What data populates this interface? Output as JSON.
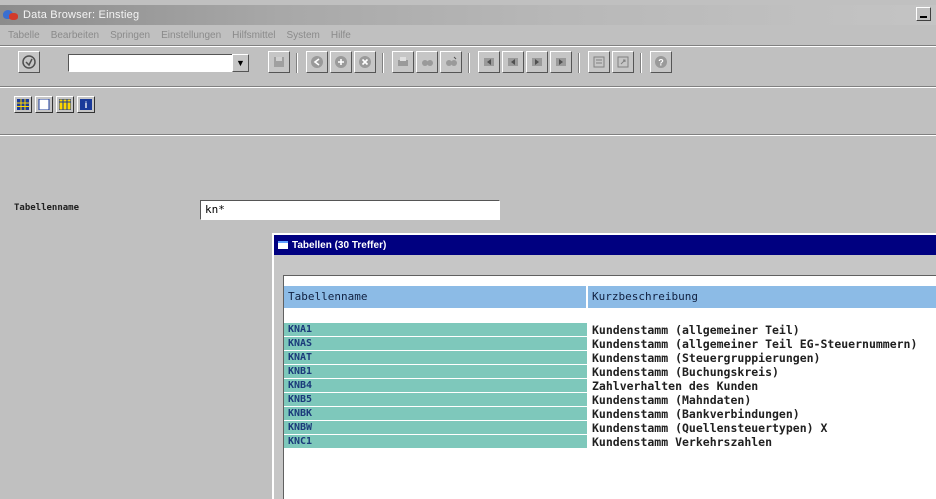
{
  "window": {
    "title": "Data Browser: Einstieg"
  },
  "menu": [
    "Tabelle",
    "Bearbeiten",
    "Springen",
    "Einstellungen",
    "Hilfsmittel",
    "System",
    "Hilfe"
  ],
  "toolbar": {
    "command_value": "",
    "buttons": [
      "enter-icon",
      "save-icon",
      "back-icon",
      "exit-icon",
      "cancel-icon",
      "print-icon",
      "find-icon",
      "find-next-icon",
      "first-page-icon",
      "prev-page-icon",
      "next-page-icon",
      "last-page-icon",
      "create-session-icon",
      "shortcut-icon",
      "help-icon"
    ]
  },
  "app_toolbar": {
    "buttons": [
      "table-contents-icon",
      "new-entries-icon",
      "table-icon",
      "info-icon"
    ]
  },
  "form": {
    "label": "Tabellenname",
    "value": "kn*"
  },
  "popup": {
    "title": "Tabellen (30 Treffer)",
    "headers": [
      "Tabellenname",
      "Kurzbeschreibung"
    ],
    "rows": [
      {
        "name": "KNA1",
        "desc": "Kundenstamm (allgemeiner Teil)"
      },
      {
        "name": "KNAS",
        "desc": "Kundenstamm (allgemeiner Teil EG-Steuernummern)"
      },
      {
        "name": "KNAT",
        "desc": "Kundenstamm (Steuergruppierungen)"
      },
      {
        "name": "KNB1",
        "desc": "Kundenstamm (Buchungskreis)"
      },
      {
        "name": "KNB4",
        "desc": "Zahlverhalten des Kunden"
      },
      {
        "name": "KNB5",
        "desc": "Kundenstamm (Mahndaten)"
      },
      {
        "name": "KNBK",
        "desc": "Kundenstamm (Bankverbindungen)"
      },
      {
        "name": "KNBW",
        "desc": "Kundenstamm (Quellensteuertypen) X"
      },
      {
        "name": "KNC1",
        "desc": "Kundenstamm Verkehrszahlen"
      }
    ]
  }
}
